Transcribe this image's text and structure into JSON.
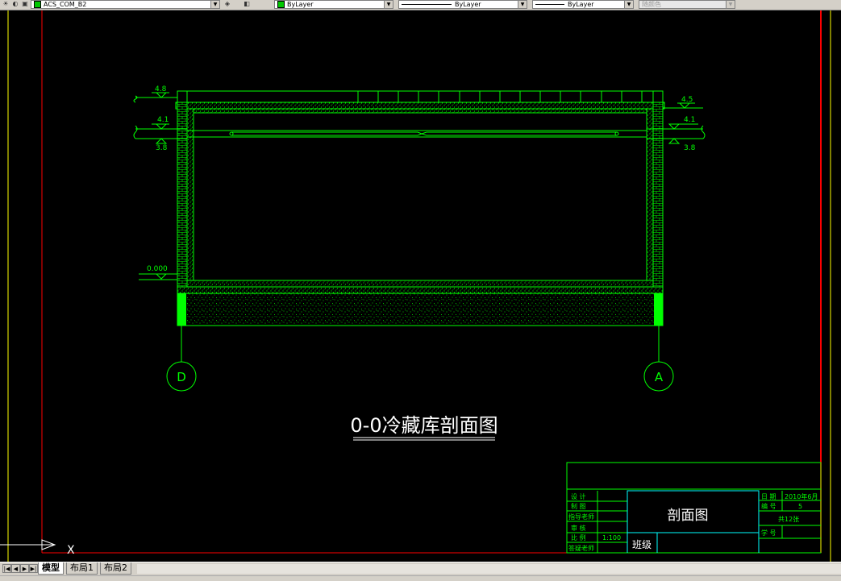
{
  "toolbar": {
    "layer_name": "ACS_COM_B2",
    "color_control": "ByLayer",
    "linetype_control": "ByLayer",
    "lineweight_control": "ByLayer",
    "plotstyle_control": "随颜色"
  },
  "drawing": {
    "title": "0-0冷藏库剖面图",
    "elevations": {
      "left_top": "4.8",
      "left_mid": "4.1",
      "left_low": "3.8",
      "left_ground": "0.000",
      "right_top": "4.5",
      "right_mid": "4.1",
      "right_low": "3.8"
    },
    "grid_axes": {
      "left": "D",
      "right": "A"
    },
    "ucs_label": "X"
  },
  "title_block": {
    "design_label": "设  计",
    "draw_label": "制  图",
    "advisor_label": "指导老师",
    "review_label": "审  核",
    "scale_label": "比  例",
    "scale_value": "1:100",
    "qa_label": "答疑老师",
    "drawing_name": "剖面图",
    "class_label": "班级",
    "date_label": "日  期",
    "date_value": "2010年6月",
    "number_label": "编  号",
    "number_value": "5",
    "sheets_value": "共12张",
    "student_label": "学  号"
  },
  "tabs": [
    {
      "label": "模型",
      "active": true
    },
    {
      "label": "布局1",
      "active": false
    },
    {
      "label": "布局2",
      "active": false
    }
  ],
  "colors": {
    "cad_green": "#00ff00",
    "frame_red": "#ff0000",
    "frame_yellow": "#ffff00",
    "title_cyan": "#00ffff",
    "background": "#000000"
  }
}
